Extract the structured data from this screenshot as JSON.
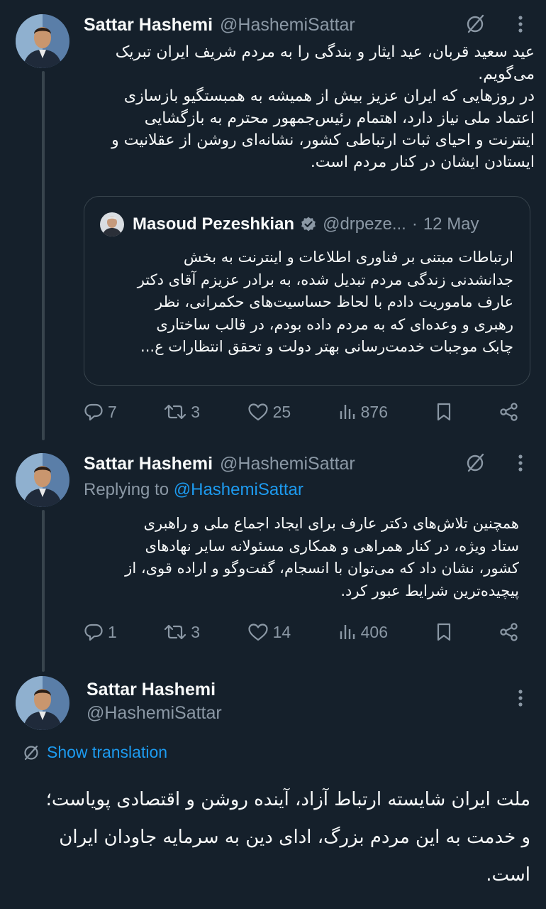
{
  "tweet1": {
    "name": "Sattar Hashemi",
    "handle": "@HashemiSattar",
    "text_lines": [
      "عید سعید قربان، عید ایثار و بندگی را به مردم شریف ایران تبریک",
      "می‌گویم.",
      "در روزهایی که ایران عزیز بیش از همیشه به همبستگیو بازسازی",
      "اعتماد ملی نیاز دارد، اهتمام رئیس‌جمهور محترم به بازگشایی",
      "اینترنت و احیای ثبات ارتباطی کشور، نشانه‌ای روشن از عقلانیت و",
      "ایستادن ایشان در کنار مردم است."
    ],
    "quote": {
      "name": "Masoud Pezeshkian",
      "handle": "@drpeze...",
      "dot": "·",
      "date": "12 May",
      "text_lines": [
        "ارتباطات مبتنی بر فناوری اطلاعات و اینترنت به بخش",
        "جدانشدنی زندگی مردم تبدیل شده، به برادر عزیزم آقای دکتر",
        "عارف ماموریت دادم با لحاظ حساسیت‌های حکمرانی، نظر",
        "رهبری و وعده‌ای که به مردم داده بودم، در قالب ساختاری",
        "چابک موجبات خدمت‌رسانی بهتر دولت و تحقق انتظارات ع..."
      ]
    },
    "stats": {
      "replies": "7",
      "reposts": "3",
      "likes": "25",
      "views": "876"
    }
  },
  "tweet2": {
    "name": "Sattar Hashemi",
    "handle": "@HashemiSattar",
    "replying_prefix": "Replying to ",
    "replying_handle": "@HashemiSattar",
    "text_lines": [
      "همچنین تلاش‌های دکتر عارف برای ایجاد اجماع ملی و راهبری",
      "ستاد ویژه، در کنار همراهی و همکاری مسئولانه سایر نهادهای",
      "کشور، نشان داد که می‌توان با انسجام، گفت‌وگو و اراده قوی، از",
      "پیچیده‌ترین شرایط عبور کرد."
    ],
    "stats": {
      "replies": "1",
      "reposts": "3",
      "likes": "14",
      "views": "406"
    }
  },
  "tweet3": {
    "name": "Sattar Hashemi",
    "handle": "@HashemiSattar",
    "translate_label": "Show translation",
    "text_lines": [
      "ملت ایران شایسته ارتباط آزاد، آینده روشن و اقتصادی پویاست؛",
      "و خدمت به این مردم بزرگ، ادای دین به سرمایه جاودان ایران",
      "است."
    ]
  },
  "colors": {
    "background": "#15202b",
    "text": "#f7f9f9",
    "secondary": "#8b98a5",
    "accent": "#1d9bf0",
    "border": "#38444d"
  },
  "icons": [
    "grok-icon",
    "more-icon",
    "reply-icon",
    "repost-icon",
    "like-icon",
    "views-icon",
    "bookmark-icon",
    "share-icon",
    "verified-icon",
    "translate-icon"
  ]
}
